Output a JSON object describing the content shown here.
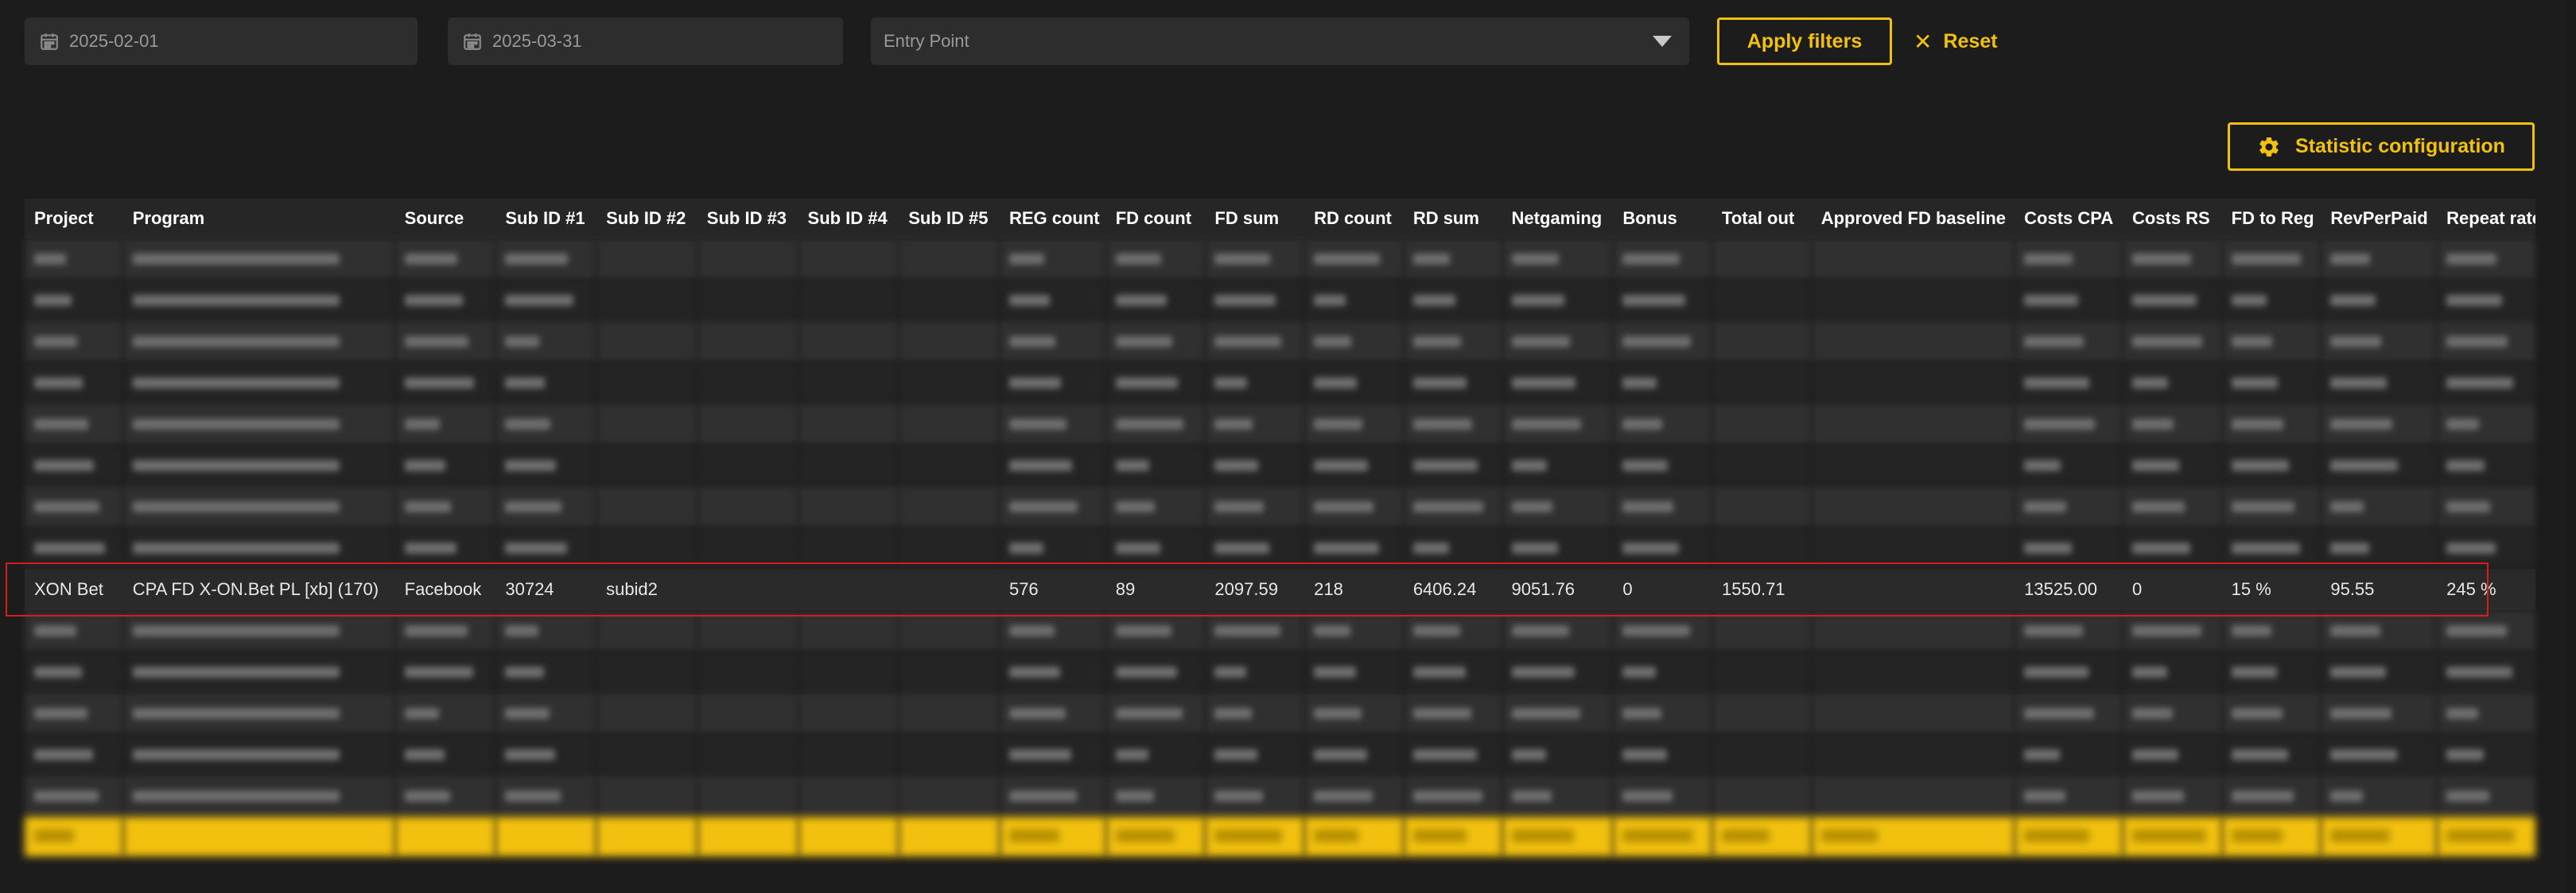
{
  "filters": {
    "date_from": "2025-02-01",
    "date_to": "2025-03-31",
    "entry_point_placeholder": "Entry Point",
    "apply_label": "Apply filters",
    "reset_label": "Reset"
  },
  "config_button_label": "Statistic configuration",
  "table": {
    "columns": [
      "Project",
      "Program",
      "Source",
      "Sub ID #1",
      "Sub ID #2",
      "Sub ID #3",
      "Sub ID #4",
      "Sub ID #5",
      "REG count",
      "FD count",
      "FD sum",
      "RD count",
      "RD sum",
      "Netgaming",
      "Bonus",
      "Total out",
      "Approved FD baseline",
      "Costs CPA",
      "Costs RS",
      "FD to Reg",
      "RevPerPaid",
      "Repeat rate"
    ],
    "focus_row": {
      "cells": [
        "XON Bet",
        "CPA FD X-ON.Bet PL [xb] (170)",
        "Facebook",
        "30724",
        "subid2",
        "",
        "",
        "",
        "576",
        "89",
        "2097.59",
        "218",
        "6406.24",
        "9051.76",
        "0",
        "1550.71",
        "",
        "13525.00",
        "0",
        "15 %",
        "95.55",
        "245 %"
      ]
    }
  },
  "colors": {
    "accent": "#f2c10f",
    "highlight_border": "#d81c1c",
    "background": "#1c1c1c"
  },
  "icons": {
    "date_from": "calendar-icon",
    "date_to": "calendar-icon",
    "entry_point": "caret-down-icon",
    "reset": "close-icon",
    "config": "gear-icon"
  }
}
